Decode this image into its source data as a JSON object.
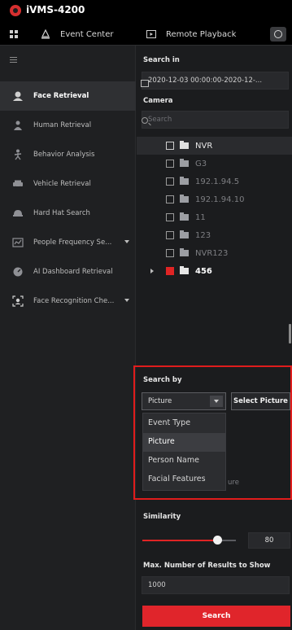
{
  "app": {
    "title": "iVMS-4200"
  },
  "tabs": [
    {
      "label": "Event Center",
      "icon": "alarm-icon"
    },
    {
      "label": "Remote Playback",
      "icon": "playback-icon"
    }
  ],
  "sidebar": {
    "items": [
      {
        "label": "Face Retrieval",
        "icon": "face-icon",
        "active": true
      },
      {
        "label": "Human Retrieval",
        "icon": "human-icon"
      },
      {
        "label": "Behavior Analysis",
        "icon": "behavior-icon"
      },
      {
        "label": "Vehicle Retrieval",
        "icon": "vehicle-icon"
      },
      {
        "label": "Hard Hat Search",
        "icon": "hard-hat-icon"
      },
      {
        "label": "People Frequency Se...",
        "icon": "frequency-icon",
        "expandable": true
      },
      {
        "label": "AI Dashboard Retrieval",
        "icon": "ai-dashboard-icon"
      },
      {
        "label": "Face Recognition Che...",
        "icon": "face-check-icon",
        "expandable": true
      }
    ]
  },
  "panel": {
    "search_in_label": "Search in",
    "time_range": "2020-12-03 00:00:00-2020-12-...",
    "camera_label": "Camera",
    "camera_search_placeholder": "Search",
    "tree": [
      {
        "name": "NVR",
        "checked": false
      },
      {
        "name": "G3",
        "checked": false
      },
      {
        "name": "192.1.94.5",
        "checked": false
      },
      {
        "name": "192.1.94.10",
        "checked": false
      },
      {
        "name": "11",
        "checked": false
      },
      {
        "name": "123",
        "checked": false
      },
      {
        "name": "NVR123",
        "checked": false
      },
      {
        "name": "456",
        "checked": true
      }
    ],
    "search_by_label": "Search by",
    "search_by_value": "Picture",
    "select_picture_label": "Select Picture",
    "search_by_options": [
      "Event Type",
      "Picture",
      "Person Name",
      "Facial Features"
    ],
    "obscured_text_fragment": "ure",
    "similarity_label": "Similarity",
    "similarity_value": "80",
    "max_results_label": "Max. Number of Results to Show",
    "max_results_value": "1000",
    "search_button_label": "Search"
  },
  "colors": {
    "accent": "#e0252b",
    "highlight_border": "#e01c1c",
    "background": "#1b1c1e"
  }
}
